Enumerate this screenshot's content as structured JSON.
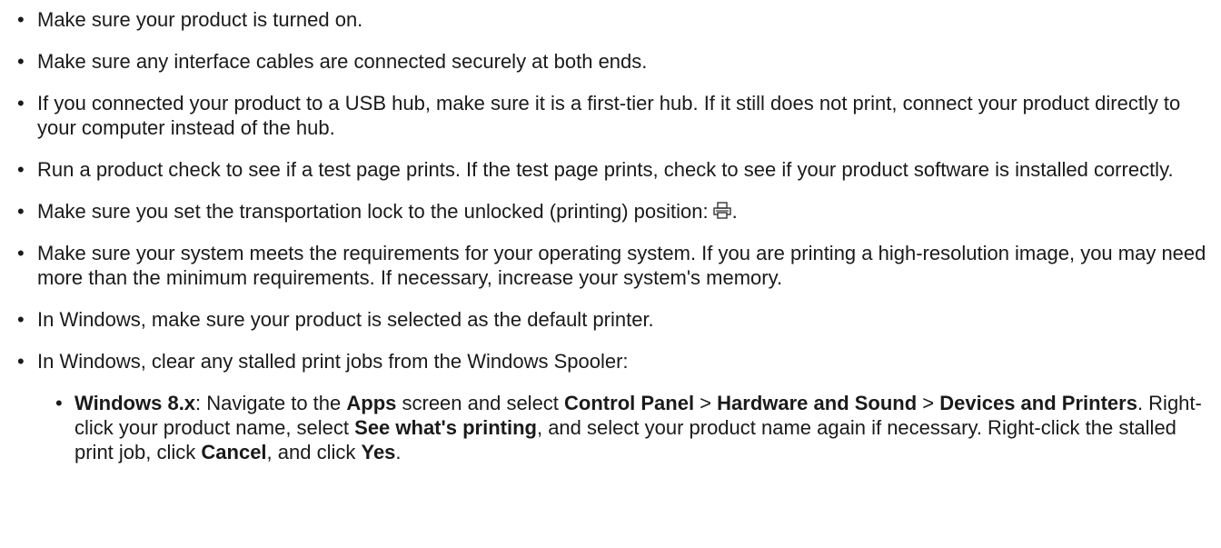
{
  "items": [
    {
      "text": "Make sure your product is turned on."
    },
    {
      "text": "Make sure any interface cables are connected securely at both ends."
    },
    {
      "text": "If you connected your product to a USB hub, make sure it is a first-tier hub. If it still does not print, connect your product directly to your computer instead of the hub."
    },
    {
      "text": "Run a product check to see if a test page prints. If the test page prints, check to see if your product software is installed correctly."
    },
    {
      "text_before": "Make sure you set the transportation lock to the unlocked (printing) position:",
      "icon": "printer-lock-icon",
      "text_after": "."
    },
    {
      "text": "Make sure your system meets the requirements for your operating system. If you are printing a high-resolution image, you may need more than the minimum requirements. If necessary, increase your system's memory."
    },
    {
      "text": "In Windows, make sure your product is selected as the default printer."
    },
    {
      "text": "In Windows, clear any stalled print jobs from the Windows Spooler:"
    }
  ],
  "subitem": {
    "os_label": "Windows 8.x",
    "t1": ": Navigate to the ",
    "apps": "Apps",
    "t2": " screen and select ",
    "control_panel": "Control Panel",
    "sep1": " > ",
    "hardware_sound": "Hardware and Sound",
    "sep2": " > ",
    "devices_printers": "Devices and Printers",
    "t3": ". Right-click your product name, select ",
    "see_printing": "See what's printing",
    "t4": ", and select your product name again if necessary. Right-click the stalled print job, click ",
    "cancel": "Cancel",
    "t5": ", and click ",
    "yes": "Yes",
    "t6": "."
  }
}
